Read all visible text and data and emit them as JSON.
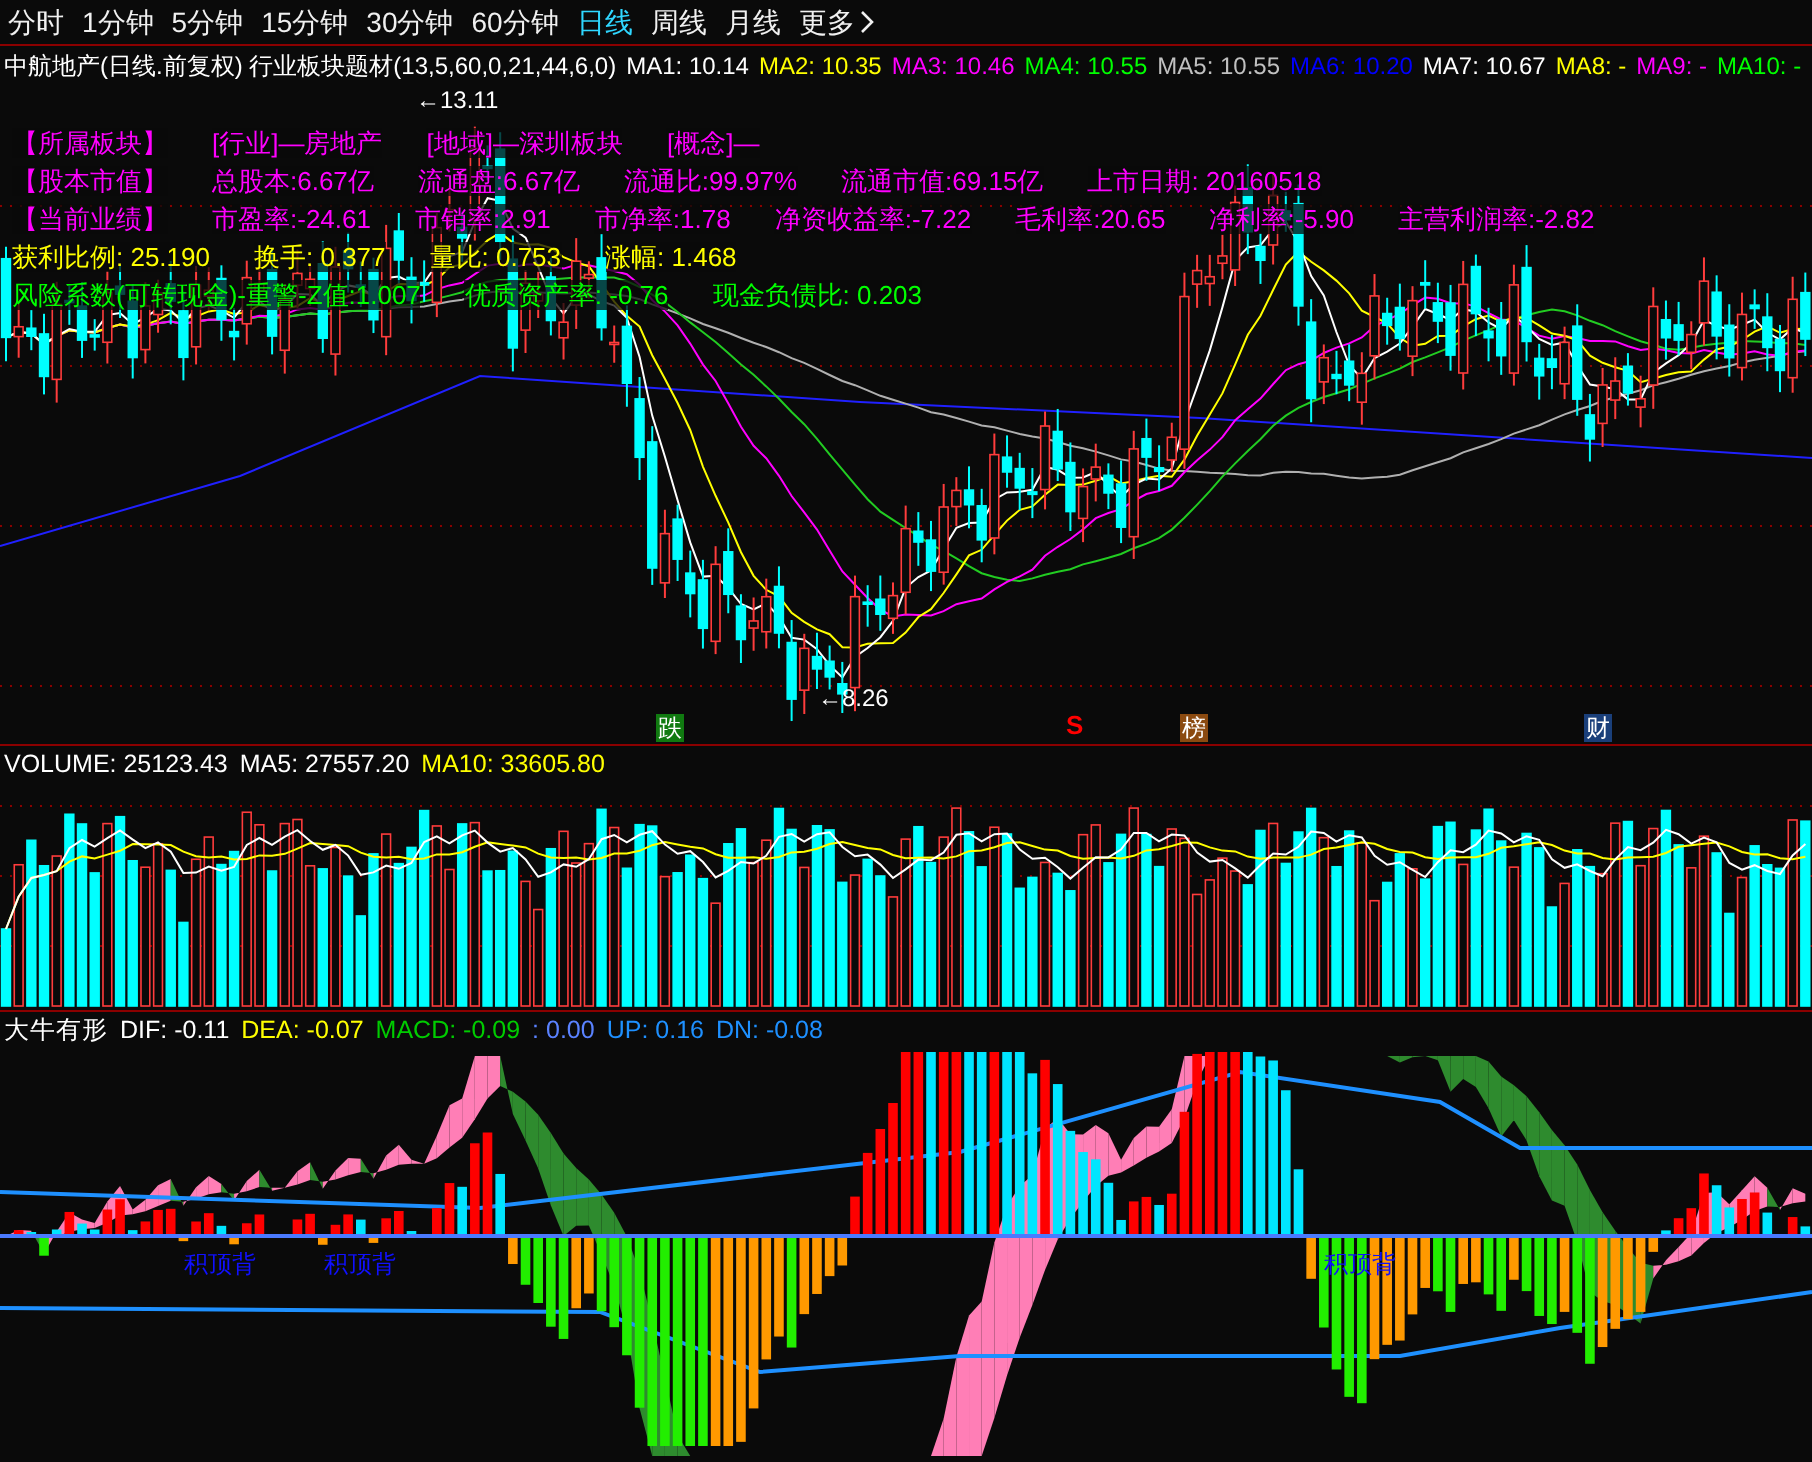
{
  "periods": [
    {
      "label": "分时",
      "selected": false
    },
    {
      "label": "1分钟",
      "selected": false
    },
    {
      "label": "5分钟",
      "selected": false
    },
    {
      "label": "15分钟",
      "selected": false
    },
    {
      "label": "30分钟",
      "selected": false
    },
    {
      "label": "60分钟",
      "selected": false
    },
    {
      "label": "日线",
      "selected": true
    },
    {
      "label": "周线",
      "selected": false
    },
    {
      "label": "月线",
      "selected": false
    }
  ],
  "more": {
    "label": "更多"
  },
  "main_chart": {
    "title": "中航地产(日线.前复权) 行业板块题材(13,5,60,0,21,44,6,0)",
    "ma_legend": [
      {
        "label": "MA1:",
        "value": "10.14",
        "color": "#ffffff"
      },
      {
        "label": "MA2:",
        "value": "10.35",
        "color": "#ffff00"
      },
      {
        "label": "MA3:",
        "value": "10.46",
        "color": "#ff00ff"
      },
      {
        "label": "MA4:",
        "value": "10.55",
        "color": "#00ff00"
      },
      {
        "label": "MA5:",
        "value": "10.55",
        "color": "#c0c0c0"
      },
      {
        "label": "MA6:",
        "value": "10.20",
        "color": "#0000ff"
      },
      {
        "label": "MA7:",
        "value": "10.67",
        "color": "#ffffff"
      },
      {
        "label": "MA8:",
        "value": "-",
        "color": "#ffff00"
      },
      {
        "label": "MA9:",
        "value": "-",
        "color": "#ff00ff"
      },
      {
        "label": "MA10:",
        "value": "-",
        "color": "#00ff00"
      }
    ],
    "info_rows": [
      {
        "color": "#ff00ff",
        "items": [
          "【所属板块】",
          "[行业]—房地产",
          "[地域]—深圳板块",
          "[概念]—"
        ]
      },
      {
        "color": "#ff00ff",
        "items": [
          "【股本市值】",
          "总股本:6.67亿",
          "流通盘:6.67亿",
          "流通比:99.97%",
          "流通市值:69.15亿",
          "上市日期: 20160518"
        ]
      },
      {
        "color": "#ff00ff",
        "items": [
          "【当前业绩】",
          "市盈率:-24.61",
          "市销率:2.91",
          "市净率:1.78",
          "净资收益率:-7.22",
          "毛利率:20.65",
          "净利率:-5.90",
          "主营利润率:-2.82"
        ]
      },
      {
        "color": "#ffff00",
        "items": [
          "获利比例:  25.190",
          "换手:  0.377",
          "量比:  0.753",
          "涨幅:  1.468"
        ]
      },
      {
        "color": "#00ff00",
        "items": [
          "风险系数(可转现金)-重警-Z值:1.007",
          "优质资产率: -0.76",
          "现金负债比: 0.203"
        ]
      }
    ],
    "high_label": "←13.11",
    "low_label": "←8.26",
    "markers": [
      {
        "label": "跌",
        "kind": "box",
        "color": "#107a10"
      },
      {
        "label": "S",
        "kind": "arrow",
        "color": "#ff0000"
      },
      {
        "label": "榜",
        "kind": "box",
        "color": "#8b4a10"
      },
      {
        "label": "财",
        "kind": "box",
        "color": "#1a3f7a"
      }
    ]
  },
  "volume": {
    "items": [
      {
        "text": "VOLUME: 25123.43",
        "color": "#ffffff"
      },
      {
        "text": "MA5: 27557.20",
        "color": "#ffffff"
      },
      {
        "text": "MA10: 33605.80",
        "color": "#ffff00"
      }
    ]
  },
  "macd": {
    "title": "大牛有形",
    "items": [
      {
        "text": "DIF: -0.11",
        "color": "#ffffff"
      },
      {
        "text": "DEA: -0.07",
        "color": "#ffff00"
      },
      {
        "text": "MACD: -0.09",
        "color": "#00cc00"
      },
      {
        "text": ": 0.00",
        "color": "#5a82ff"
      },
      {
        "text": "UP: 0.16",
        "color": "#1e90ff"
      },
      {
        "text": "DN: -0.08",
        "color": "#1e90ff"
      }
    ],
    "signals": [
      "积顶背",
      "积顶背",
      "积顶背"
    ]
  }
}
